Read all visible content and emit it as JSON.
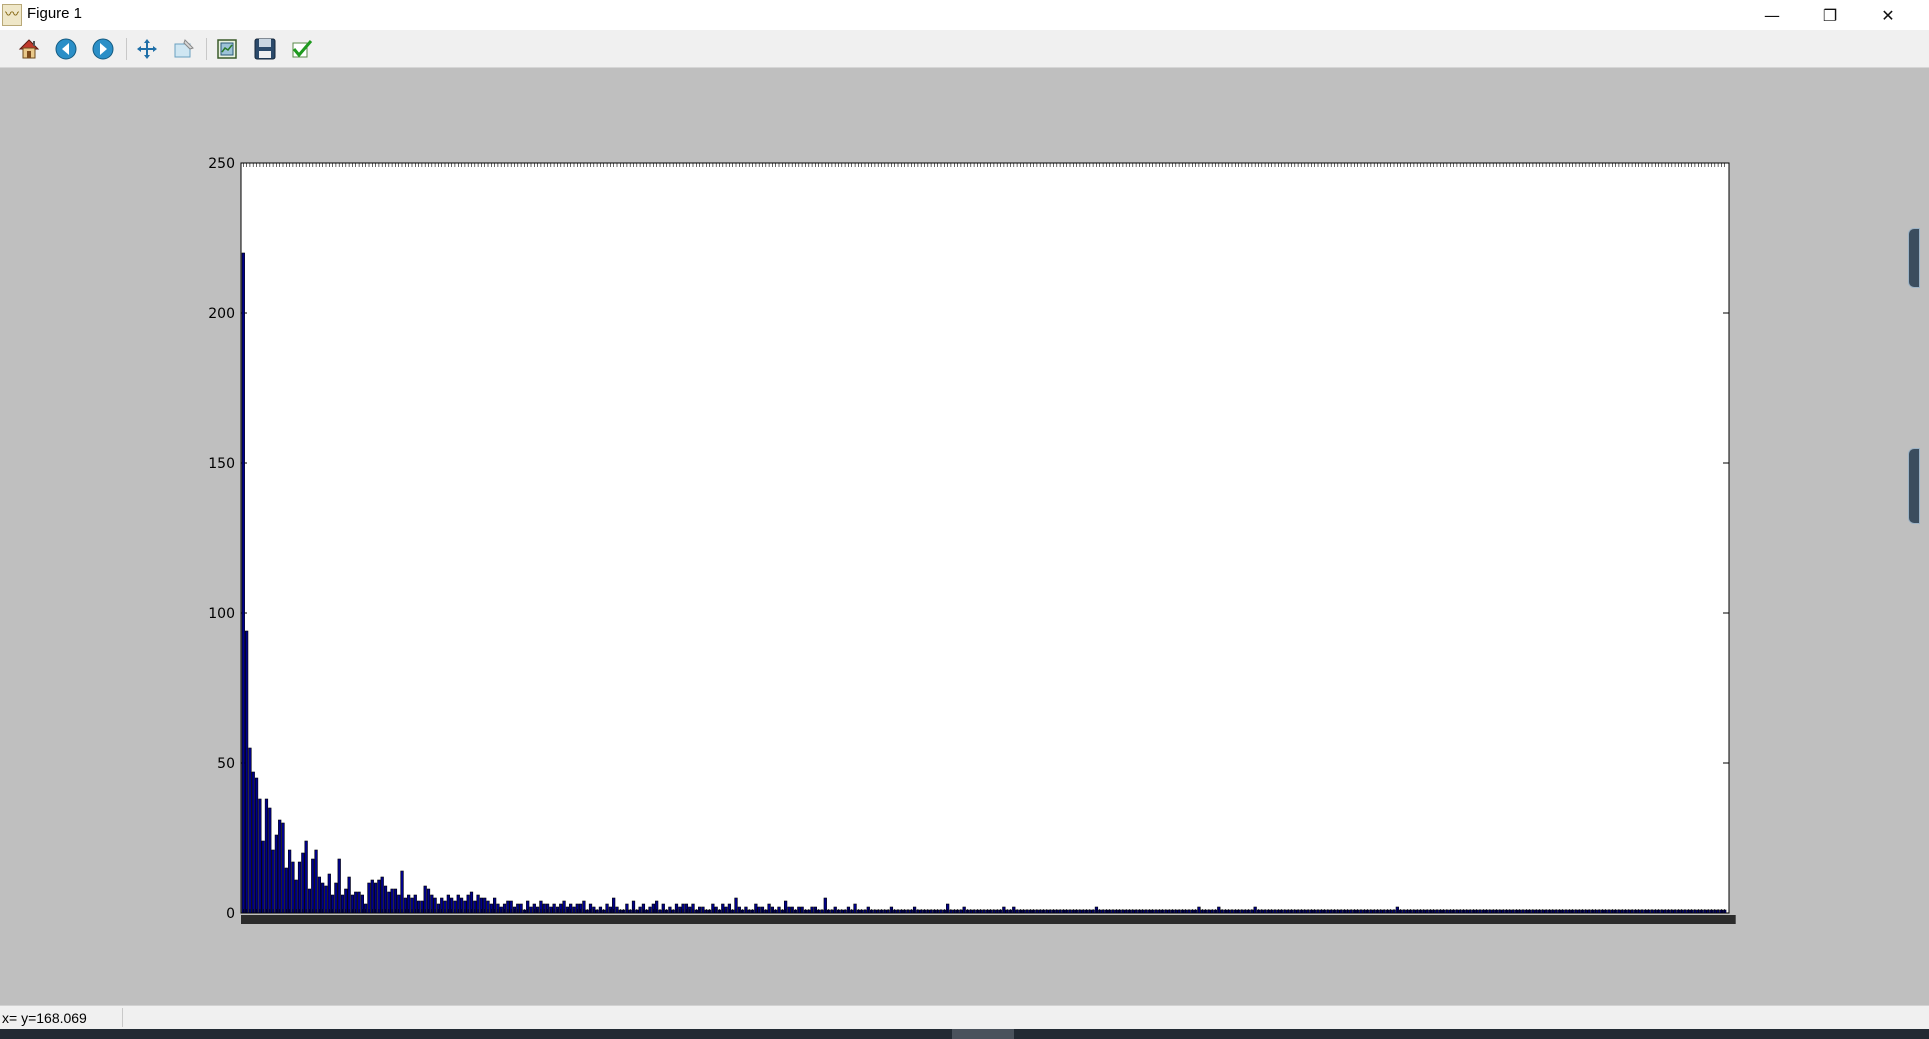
{
  "window": {
    "title": "Figure 1",
    "app_icon": "matplotlib-icon"
  },
  "window_controls": {
    "minimize": "—",
    "restore": "❐",
    "close": "✕"
  },
  "toolbar": {
    "items": [
      {
        "name": "home",
        "icon": "home-icon"
      },
      {
        "name": "back",
        "icon": "back-arrow-icon"
      },
      {
        "name": "forward",
        "icon": "forward-arrow-icon"
      },
      {
        "name": "pan",
        "icon": "move-arrows-icon"
      },
      {
        "name": "zoom",
        "icon": "zoom-rect-icon"
      },
      {
        "name": "subplots",
        "icon": "subplots-config-icon"
      },
      {
        "name": "save",
        "icon": "floppy-save-icon"
      },
      {
        "name": "edit",
        "icon": "checkmark-edit-icon"
      }
    ]
  },
  "status": {
    "text": "x= y=168.069"
  },
  "colors": {
    "bar_fill": "#00008b",
    "axes_bg": "#ffffff",
    "figure_bg": "#bfbfbf"
  },
  "chart_data": {
    "type": "bar",
    "ylim": [
      0,
      250
    ],
    "yticks": [
      0,
      50,
      100,
      150,
      200,
      250
    ],
    "ytick_labels": [
      "0",
      "50",
      "100",
      "150",
      "200",
      "250"
    ],
    "xlim_categories": 450,
    "grid": false,
    "values": [
      220,
      94,
      55,
      47,
      45,
      38,
      24,
      38,
      35,
      21,
      26,
      31,
      30,
      15,
      21,
      17,
      11,
      17,
      20,
      24,
      8,
      18,
      21,
      12,
      10,
      9,
      13,
      6,
      10,
      18,
      6,
      8,
      12,
      6,
      7,
      7,
      6,
      3,
      10,
      11,
      10,
      11,
      12,
      9,
      7,
      8,
      8,
      6,
      14,
      5,
      6,
      5,
      6,
      4,
      4,
      9,
      8,
      6,
      5,
      3,
      5,
      4,
      6,
      5,
      4,
      6,
      5,
      4,
      6,
      7,
      4,
      6,
      5,
      5,
      4,
      3,
      5,
      3,
      2,
      3,
      4,
      4,
      2,
      3,
      3,
      1,
      4,
      2,
      3,
      2,
      4,
      3,
      3,
      2,
      3,
      2,
      3,
      4,
      2,
      3,
      2,
      3,
      3,
      4,
      1,
      3,
      2,
      1,
      2,
      1,
      3,
      2,
      5,
      2,
      1,
      1,
      3,
      1,
      4,
      1,
      2,
      3,
      1,
      2,
      3,
      4,
      1,
      3,
      1,
      2,
      1,
      3,
      2,
      3,
      3,
      2,
      3,
      1,
      2,
      2,
      1,
      1,
      3,
      2,
      1,
      3,
      2,
      3,
      1,
      5,
      2,
      1,
      2,
      1,
      1,
      3,
      2,
      2,
      1,
      3,
      2,
      1,
      2,
      1,
      4,
      2,
      2,
      1,
      2,
      2,
      1,
      1,
      2,
      2,
      1,
      1,
      5,
      1,
      1,
      2,
      1,
      1,
      1,
      2,
      1,
      3,
      1,
      1,
      1,
      2,
      1,
      1,
      1,
      1,
      1,
      1,
      2,
      1,
      1,
      1,
      1,
      1,
      1,
      2,
      1,
      1,
      1,
      1,
      1,
      1,
      1,
      1,
      1,
      3,
      1,
      1,
      1,
      1,
      2,
      1,
      1,
      1,
      1,
      1,
      1,
      1,
      1,
      1,
      1,
      1,
      2,
      1,
      1,
      2,
      1,
      1,
      1,
      1,
      1,
      1,
      1,
      1,
      1,
      1,
      1,
      1,
      1,
      1,
      1,
      1,
      1,
      1,
      1,
      1,
      1,
      1,
      1,
      1,
      2,
      1,
      1,
      1,
      1,
      1,
      1,
      1,
      1,
      1,
      1,
      1,
      1,
      1,
      1,
      1,
      1,
      1,
      1,
      1,
      1,
      1,
      1,
      1,
      1,
      1,
      1,
      1,
      1,
      1,
      1,
      2,
      1,
      1,
      1,
      1,
      1,
      2,
      1,
      1,
      1,
      1,
      1,
      1,
      1,
      1,
      1,
      1,
      2,
      1,
      1,
      1,
      1,
      1,
      1,
      1,
      1,
      1,
      1,
      1,
      1,
      1,
      1,
      1,
      1,
      1,
      1,
      1,
      1,
      1,
      1,
      1,
      1,
      1,
      1,
      1,
      1,
      1,
      1,
      1,
      1,
      1,
      1,
      1,
      1,
      1,
      1,
      1,
      1,
      1,
      1,
      2,
      1,
      1,
      1,
      1,
      1,
      1,
      1,
      1,
      1,
      1,
      1,
      1,
      1,
      1,
      1,
      1,
      1,
      1,
      1,
      1,
      1,
      1,
      1,
      1,
      1,
      1,
      1,
      1,
      1,
      1,
      1,
      1,
      1,
      1,
      1,
      1,
      1,
      1,
      1,
      1,
      1,
      1,
      1,
      1,
      1,
      1,
      1,
      1,
      1,
      1,
      1,
      1,
      1,
      1,
      1,
      1,
      1,
      1,
      1,
      1,
      1,
      1,
      1,
      1,
      1,
      1,
      1,
      1,
      1,
      1,
      1,
      1,
      1,
      1,
      1,
      1,
      1,
      1,
      1,
      1,
      1,
      1,
      1,
      1,
      1,
      1,
      1,
      1,
      1,
      1,
      1,
      1,
      1,
      1,
      1,
      1,
      1,
      1,
      1
    ]
  }
}
